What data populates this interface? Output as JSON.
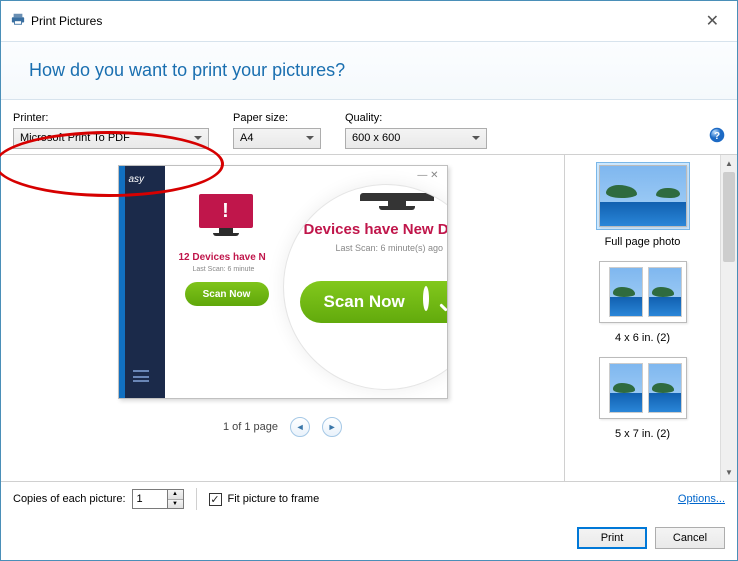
{
  "window": {
    "title": "Print Pictures",
    "close_glyph": "✕"
  },
  "banner": {
    "heading": "How do you want to print your pictures?"
  },
  "options": {
    "printer_label": "Printer:",
    "printer_value": "Microsoft Print To PDF",
    "paper_label": "Paper size:",
    "paper_value": "A4",
    "quality_label": "Quality:",
    "quality_value": "600 x 600"
  },
  "preview": {
    "pager_text": "1 of 1 page",
    "content": {
      "sidebar_brand_fragment": "asy",
      "devices_headline_fragment": "Devices have New Dri",
      "last_scan_text": "Last Scan: 6 minute(s) ago",
      "small_headline": "12 Devices have N",
      "small_sub": "Last Scan: 6 minute",
      "small_button": "Scan Now",
      "big_button": "Scan Now",
      "win_buttons": "—  ✕"
    }
  },
  "layouts": [
    {
      "label": "Full page photo",
      "kind": "landscape",
      "selected": true
    },
    {
      "label": "4 x 6 in. (2)",
      "kind": "portrait-pair",
      "selected": false
    },
    {
      "label": "5 x 7 in. (2)",
      "kind": "portrait-pair",
      "selected": false
    }
  ],
  "footer": {
    "copies_label": "Copies of each picture:",
    "copies_value": "1",
    "fit_label": "Fit picture to frame",
    "fit_checked": true,
    "options_link": "Options..."
  },
  "buttons": {
    "print": "Print",
    "cancel": "Cancel"
  }
}
